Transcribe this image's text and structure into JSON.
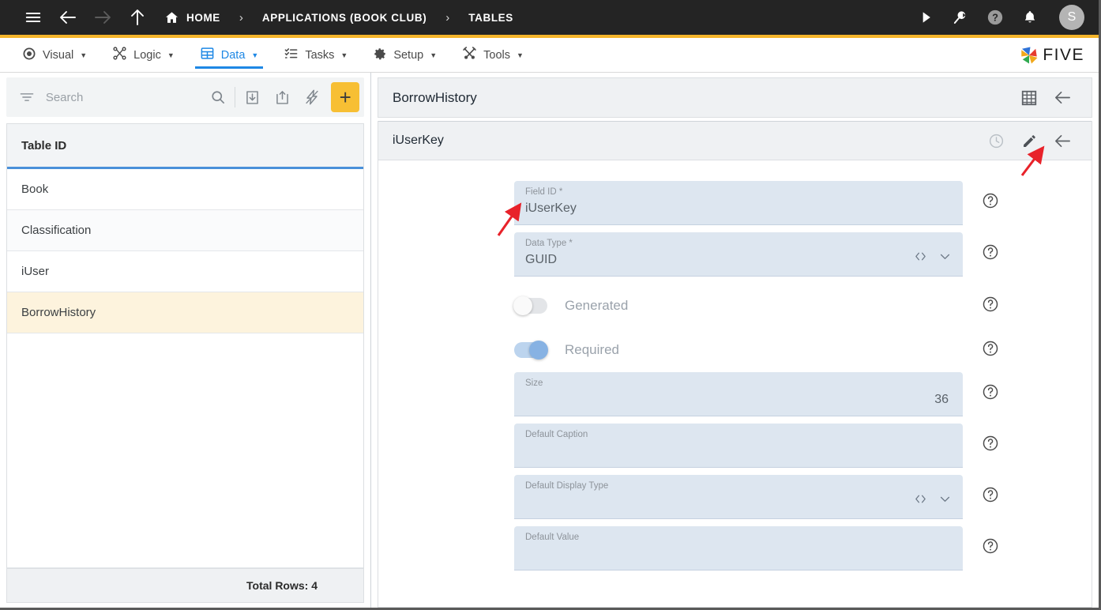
{
  "topbar": {
    "icons": [
      "menu-icon",
      "back-arrow-icon",
      "forward-arrow-icon",
      "up-arrow-icon"
    ],
    "home_label": "HOME",
    "breadcrumbs": [
      "HOME",
      "APPLICATIONS (BOOK CLUB)",
      "TABLES"
    ],
    "separator": "›",
    "right_icons": [
      "play-icon",
      "search-spark-icon",
      "help-icon",
      "bell-icon"
    ],
    "avatar_initial": "S",
    "accent_color": "#f5b52b",
    "background_color": "#242424"
  },
  "menubar": {
    "items": [
      {
        "label": "Visual",
        "icon": "eye-icon",
        "active": false
      },
      {
        "label": "Logic",
        "icon": "logic-nodes-icon",
        "active": false
      },
      {
        "label": "Data",
        "icon": "data-grid-icon",
        "active": true
      },
      {
        "label": "Tasks",
        "icon": "tasks-list-icon",
        "active": false
      },
      {
        "label": "Setup",
        "icon": "gear-icon",
        "active": false
      },
      {
        "label": "Tools",
        "icon": "tools-icon",
        "active": false
      }
    ],
    "caret": "▼",
    "brand": "FIVE",
    "active_color": "#1e88e5"
  },
  "sidebar": {
    "search": {
      "placeholder": "Search",
      "value": ""
    },
    "toolbar_icons": [
      "filter-icon",
      "search-icon",
      "import-icon",
      "export-icon",
      "lightning-icon"
    ],
    "add_label": "+",
    "column_header": "Table ID",
    "rows": [
      {
        "label": "Book",
        "selected": false
      },
      {
        "label": "Classification",
        "selected": false
      },
      {
        "label": "iUser",
        "selected": false
      },
      {
        "label": "BorrowHistory",
        "selected": true
      }
    ],
    "footer": "Total Rows: 4",
    "selected_row_color": "#fdf3dd"
  },
  "rightpane": {
    "table_title": "BorrowHistory",
    "table_icons": [
      "grid-table-icon",
      "back-arrow-icon"
    ],
    "field_title": "iUserKey",
    "field_icons": [
      "history-clock-icon",
      "edit-pencil-icon",
      "back-arrow-icon"
    ],
    "help_glyph": "?",
    "form": {
      "fields": [
        {
          "kind": "text",
          "label": "Field ID *",
          "value": "iUserKey",
          "align": "left",
          "has_dropdown": false
        },
        {
          "kind": "select",
          "label": "Data Type *",
          "value": "GUID",
          "align": "left",
          "has_dropdown": true
        },
        {
          "kind": "toggle",
          "label": "Generated",
          "on": false
        },
        {
          "kind": "toggle",
          "label": "Required",
          "on": true
        },
        {
          "kind": "number",
          "label": "Size",
          "value": "36",
          "align": "right",
          "has_dropdown": false
        },
        {
          "kind": "text",
          "label": "Default Caption",
          "value": "",
          "align": "left",
          "has_dropdown": false
        },
        {
          "kind": "select",
          "label": "Default Display Type",
          "value": "",
          "align": "left",
          "has_dropdown": true
        },
        {
          "kind": "text",
          "label": "Default Value",
          "value": "",
          "align": "left",
          "has_dropdown": false
        }
      ]
    }
  },
  "annotations": [
    {
      "name": "arrow-to-field-id",
      "color": "#e8222a"
    },
    {
      "name": "arrow-to-edit-pencil",
      "color": "#e8222a"
    }
  ]
}
